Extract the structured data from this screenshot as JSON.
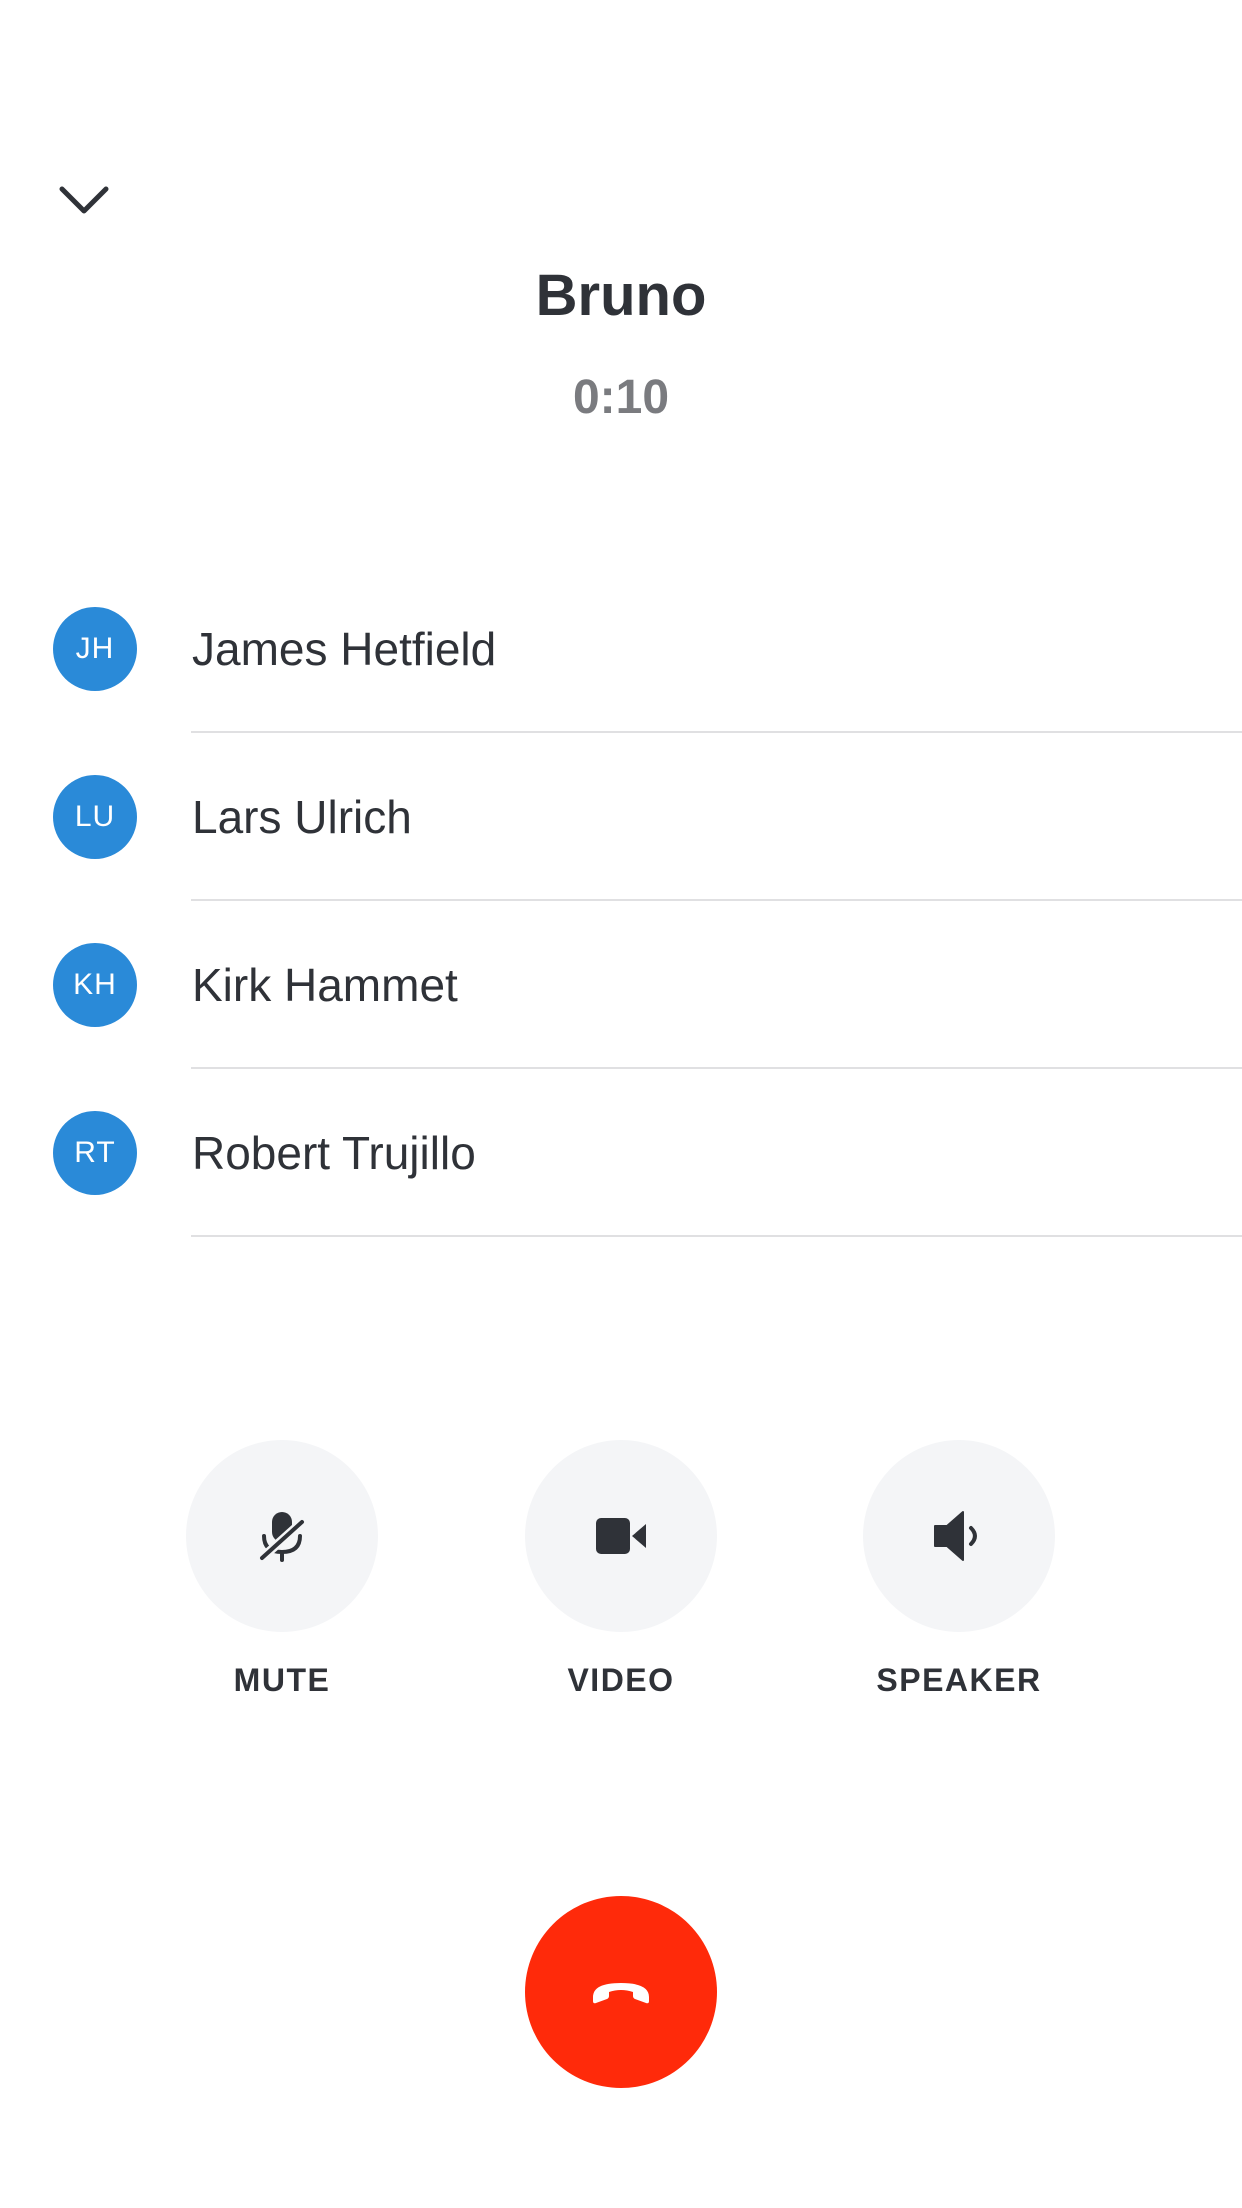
{
  "header": {
    "title": "Bruno",
    "timer": "0:10"
  },
  "participants": [
    {
      "initials": "JH",
      "name": "James Hetfield"
    },
    {
      "initials": "LU",
      "name": "Lars Ulrich"
    },
    {
      "initials": "KH",
      "name": "Kirk Hammet"
    },
    {
      "initials": "RT",
      "name": "Robert Trujillo"
    }
  ],
  "controls": {
    "mute": {
      "label": "MUTE",
      "icon": "mic-off-icon"
    },
    "video": {
      "label": "VIDEO",
      "icon": "video-camera-icon"
    },
    "speaker": {
      "label": "SPEAKER",
      "icon": "speaker-icon"
    }
  },
  "end_call": {
    "icon": "hang-up-icon"
  },
  "colors": {
    "avatar": "#2a8ad8",
    "end_call": "#ff2a0a",
    "control_bg": "#f4f5f7",
    "text": "#2f3238",
    "timer": "#7a7b7f"
  }
}
